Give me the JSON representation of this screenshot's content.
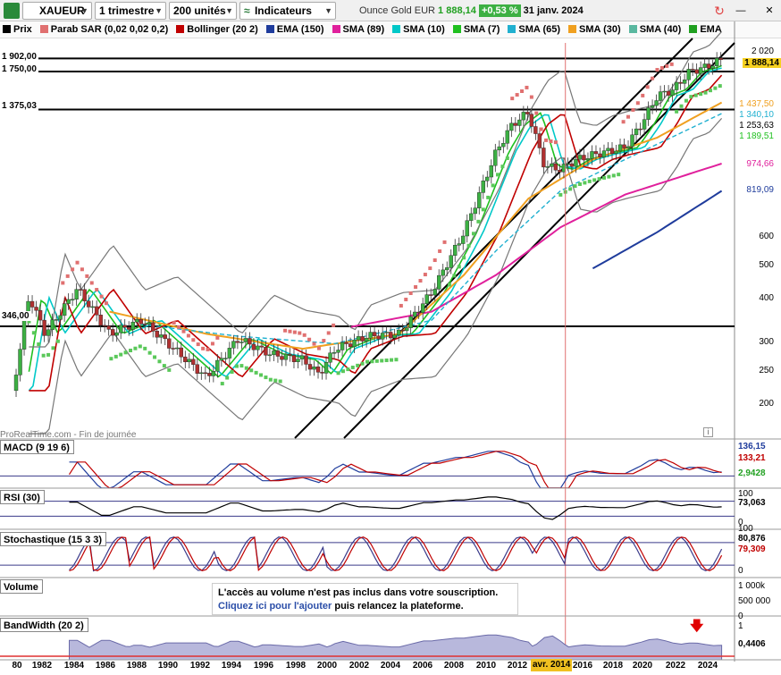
{
  "toolbar": {
    "symbol": "XAUEUR",
    "period": "1 trimestre",
    "units": "200 unités",
    "indicators": "Indicateurs",
    "instrument_name": "Ounce Gold EUR",
    "price": "1 888,14",
    "change": "+0,53 %",
    "date": "31 janv. 2024"
  },
  "indicators_bar": [
    {
      "label": "Prix",
      "color": "#000000"
    },
    {
      "label": "Parab SAR (0,02 0,02 0,2)",
      "color": "#e07070"
    },
    {
      "label": "Bollinger (20 2)",
      "color": "#c00000"
    },
    {
      "label": "EMA (150)",
      "color": "#1f3c9c"
    },
    {
      "label": "SMA (89)",
      "color": "#e0209c"
    },
    {
      "label": "SMA (10)",
      "color": "#00c8c8"
    },
    {
      "label": "SMA (7)",
      "color": "#20c020"
    },
    {
      "label": "SMA (65)",
      "color": "#20b0d0"
    },
    {
      "label": "SMA (30)",
      "color": "#f0a020"
    },
    {
      "label": "SMA (40)",
      "color": "#5ab8a0"
    },
    {
      "label": "EMA",
      "color": "#20a020"
    }
  ],
  "price_levels": [
    "1 902,00",
    "1 750,00",
    "1 375,03",
    "346,00"
  ],
  "price_axis": {
    "ticks": [
      "2 020",
      "1 888,14",
      "1 437,50",
      "1 340,10",
      "1 253,63",
      "1 189,51",
      "974,66",
      "819,09",
      "600",
      "500",
      "400",
      "300",
      "250",
      "200"
    ],
    "tick_colors": [
      "#000000",
      "#000000",
      "#f0a020",
      "#20b0d0",
      "#000000",
      "#20c020",
      "#e0209c",
      "#1f3c9c",
      "#000000",
      "#000000",
      "#000000",
      "#000000",
      "#000000",
      "#000000"
    ]
  },
  "watermark": "ProRealTime.com - Fin de journée",
  "panels": {
    "macd": {
      "label": "MACD (9 19 6)",
      "values": [
        "136,15",
        "133,21",
        "2,9428"
      ],
      "value_colors": [
        "#1f3c9c",
        "#c00000",
        "#20a020"
      ]
    },
    "rsi": {
      "label": "RSI (30)",
      "values": [
        "100",
        "73,063",
        "0"
      ]
    },
    "stoch": {
      "label": "Stochastique (15 3 3)",
      "values": [
        "100",
        "80,876",
        "79,309",
        "0"
      ],
      "value_colors": [
        "#000000",
        "#000000",
        "#c00000",
        "#000000"
      ]
    },
    "volume": {
      "label": "Volume",
      "values": [
        "1 000k",
        "500 000",
        "0"
      ]
    },
    "bandwidth": {
      "label": "BandWidth (20 2)",
      "values": [
        "1",
        "0,4406"
      ]
    }
  },
  "notice": {
    "line1": "L'accès au volume n'est pas inclus dans votre souscription.",
    "link": "Cliquez ici pour l'ajouter",
    "line2": " puis relancez la plateforme."
  },
  "x_axis": {
    "labels": [
      "80",
      "1982",
      "1984",
      "1986",
      "1988",
      "1990",
      "1992",
      "1994",
      "1996",
      "1998",
      "2000",
      "2002",
      "2004",
      "2006",
      "2008",
      "2010",
      "2012",
      "2014",
      "2016",
      "2018",
      "2020",
      "2022",
      "2024"
    ],
    "highlight": "avr. 2014"
  },
  "chart_data": {
    "type": "candlestick",
    "title": "XAUEUR",
    "subtitle": "Ounce Gold EUR",
    "scale": "log",
    "ylim": [
      170,
      2100
    ],
    "x_range": [
      "1980",
      "2024"
    ],
    "series": [
      {
        "name": "Prix",
        "points": [
          [
            1980,
            230
          ],
          [
            1981,
            420
          ],
          [
            1982,
            330
          ],
          [
            1984,
            440
          ],
          [
            1986,
            330
          ],
          [
            1988,
            360
          ],
          [
            1990,
            300
          ],
          [
            1992,
            250
          ],
          [
            1994,
            320
          ],
          [
            1996,
            290
          ],
          [
            1998,
            280
          ],
          [
            1999,
            255
          ],
          [
            2000,
            300
          ],
          [
            2002,
            325
          ],
          [
            2004,
            330
          ],
          [
            2006,
            430
          ],
          [
            2008,
            630
          ],
          [
            2010,
            1050
          ],
          [
            2011,
            1250
          ],
          [
            2012,
            1350
          ],
          [
            2013,
            960
          ],
          [
            2014,
            940
          ],
          [
            2015,
            1000
          ],
          [
            2016,
            1030
          ],
          [
            2018,
            1080
          ],
          [
            2019,
            1250
          ],
          [
            2020,
            1500
          ],
          [
            2021,
            1560
          ],
          [
            2022,
            1750
          ],
          [
            2023,
            1800
          ],
          [
            2024,
            1888.14
          ]
        ]
      },
      {
        "name": "EMA (150)",
        "points": [
          [
            2016,
            500
          ],
          [
            2020,
            630
          ],
          [
            2024,
            819.09
          ]
        ]
      },
      {
        "name": "SMA (89)",
        "points": [
          [
            2001,
            345
          ],
          [
            2006,
            380
          ],
          [
            2010,
            480
          ],
          [
            2014,
            650
          ],
          [
            2018,
            800
          ],
          [
            2024,
            974.66
          ]
        ]
      },
      {
        "name": "SMA (30)",
        "points": [
          [
            1986,
            380
          ],
          [
            1992,
            330
          ],
          [
            1998,
            300
          ],
          [
            2004,
            330
          ],
          [
            2008,
            480
          ],
          [
            2012,
            780
          ],
          [
            2016,
            1000
          ],
          [
            2020,
            1150
          ],
          [
            2024,
            1437.5
          ]
        ]
      },
      {
        "name": "SMA (65)",
        "points": [
          [
            1988,
            350
          ],
          [
            1994,
            325
          ],
          [
            2000,
            310
          ],
          [
            2006,
            360
          ],
          [
            2010,
            560
          ],
          [
            2014,
            820
          ],
          [
            2018,
            1000
          ],
          [
            2024,
            1340.1
          ]
        ]
      }
    ],
    "horizontal_levels": [
      1902,
      1750,
      1375.03,
      346
    ],
    "last_close": 1888.14,
    "grid": false,
    "legend": "top"
  }
}
